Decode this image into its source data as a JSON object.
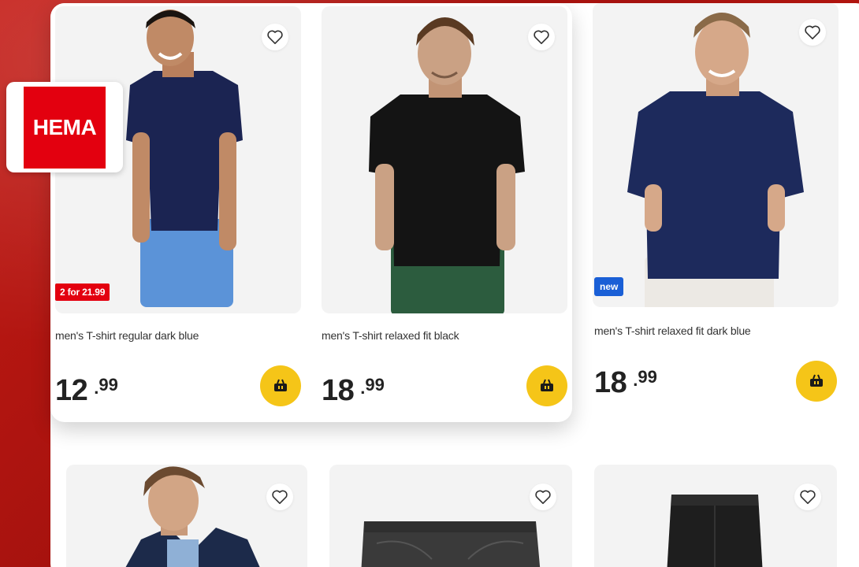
{
  "brand": {
    "logo_text": "HEMA",
    "color": "#e3000f"
  },
  "products": [
    {
      "title": "men's T-shirt regular dark blue",
      "price_euros": "12",
      "price_cents": "99",
      "badge": "2 for 21.99",
      "badge_type": "promo",
      "shirt_color": "#1b2452",
      "bottom_color": "#5b93d8"
    },
    {
      "title": "men's T-shirt relaxed fit black",
      "price_euros": "18",
      "price_cents": "99",
      "badge": "",
      "badge_type": "",
      "shirt_color": "#141414",
      "bottom_color": "#2c5c3e"
    },
    {
      "title": "men's T-shirt relaxed fit dark blue",
      "price_euros": "18",
      "price_cents": "99",
      "badge": "new",
      "badge_type": "new",
      "shirt_color": "#1d2a5c",
      "bottom_color": "#ece9e4"
    }
  ],
  "row2": [
    {
      "item": "hooded jacket",
      "color": "#1c2a4a"
    },
    {
      "item": "jeans shorts",
      "color": "#3a3a3a"
    },
    {
      "item": "black shorts",
      "color": "#1e1e1e"
    }
  ],
  "colors": {
    "cart_button": "#f5c518",
    "new_badge": "#1a5fd6",
    "promo_badge": "#e3000f"
  },
  "icons": {
    "wishlist": "heart-icon",
    "cart": "basket-icon"
  }
}
